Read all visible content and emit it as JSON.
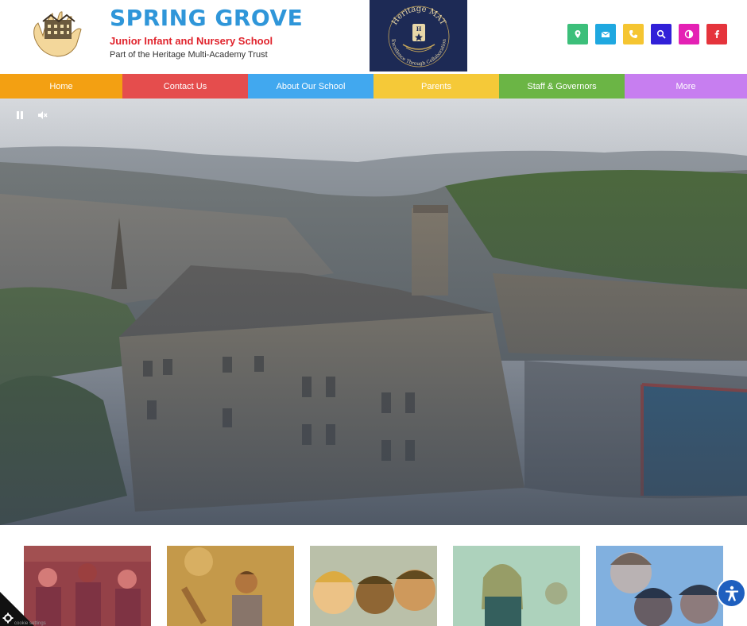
{
  "header": {
    "school_name": "SPRING GROVE",
    "school_subtitle": "Junior Infant and Nursery School",
    "trust_line": "Part of the Heritage Multi-Academy Trust",
    "mat_logo_top": "Heritage MAT",
    "mat_logo_bottom": "Excellence Through Collaboration",
    "mat_letter": "H"
  },
  "social": [
    {
      "name": "location-icon",
      "color": "#3cbf7a"
    },
    {
      "name": "email-icon",
      "color": "#1fa8e0"
    },
    {
      "name": "phone-icon",
      "color": "#f5c531"
    },
    {
      "name": "search-icon",
      "color": "#3120d8"
    },
    {
      "name": "contrast-icon",
      "color": "#e421b4"
    },
    {
      "name": "facebook-icon",
      "color": "#e5343c"
    }
  ],
  "nav": [
    {
      "label": "Home",
      "color": "#f3a012"
    },
    {
      "label": "Contact Us",
      "color": "#e54d4d"
    },
    {
      "label": "About Our School",
      "color": "#41a8ef"
    },
    {
      "label": "Parents",
      "color": "#f5c938"
    },
    {
      "label": "Staff & Governors",
      "color": "#6bb545"
    },
    {
      "label": "More",
      "color": "#c77ef0"
    }
  ],
  "hero": {
    "pause_icon": "pause-icon",
    "mute_icon": "mute-icon"
  },
  "cards": [
    {
      "tint": "#c23b4b"
    },
    {
      "tint": "#d98a2e"
    },
    {
      "tint": "#e3b23a"
    },
    {
      "tint": "#3fa36a"
    },
    {
      "tint": "#3a7fd0"
    }
  ],
  "cookie": {
    "label": "cookie settings"
  }
}
